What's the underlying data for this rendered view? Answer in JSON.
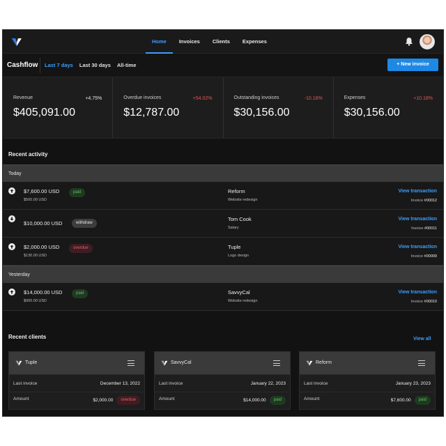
{
  "nav": {
    "items": [
      {
        "label": "Home",
        "active": true
      },
      {
        "label": "Invoices",
        "active": false
      },
      {
        "label": "Clients",
        "active": false
      },
      {
        "label": "Expenses",
        "active": false
      }
    ],
    "icons": [
      "logo-icon",
      "bell-icon",
      "avatar"
    ]
  },
  "cashflow": {
    "title": "Cashflow",
    "tabs": [
      {
        "label": "Last 7 days",
        "active": true
      },
      {
        "label": "Last 30 days",
        "active": false
      },
      {
        "label": "All-time",
        "active": false
      }
    ],
    "new_invoice_label": "+ New invoice"
  },
  "stats": [
    {
      "label": "Revenue",
      "change": "+4.75%",
      "value": "$405,091.00",
      "trend": "positive"
    },
    {
      "label": "Overdue invoices",
      "change": "+54.02%",
      "value": "$12,787.00",
      "trend": "negative"
    },
    {
      "label": "Outstanding invoices",
      "change": "-10.18%",
      "value": "$30,156.00",
      "trend": "negative"
    },
    {
      "label": "Expenses",
      "change": "+10.18%",
      "value": "$30,156.00",
      "trend": "negative"
    }
  ],
  "activity": {
    "title": "Recent activity",
    "groups": [
      {
        "label": "Today",
        "rows": [
          {
            "direction": "up",
            "amount": "$7,600.00 USD",
            "sub": "$500.00 USD",
            "status": "paid",
            "client": "Reform",
            "desc": "Website redesign",
            "link": "View transaction",
            "invoice_prefix": "Invoice",
            "invoice_no": "#00012"
          },
          {
            "direction": "down",
            "amount": "$10,000.00 USD",
            "sub": "",
            "status": "withdraw",
            "client": "Tom Cook",
            "desc": "Salary",
            "link": "View transaction",
            "invoice_prefix": "Invoice",
            "invoice_no": "#00011"
          },
          {
            "direction": "up",
            "amount": "$2,000.00 USD",
            "sub": "$130.00 USD",
            "status": "overdue",
            "client": "Tuple",
            "desc": "Logo design",
            "link": "View transaction",
            "invoice_prefix": "Invoice",
            "invoice_no": "#00009"
          }
        ]
      },
      {
        "label": "Yesterday",
        "rows": [
          {
            "direction": "up",
            "amount": "$14,000.00 USD",
            "sub": "$900.00 USD",
            "status": "paid",
            "client": "SavvyCal",
            "desc": "Website redesign",
            "link": "View transaction",
            "invoice_prefix": "Invoice",
            "invoice_no": "#00010"
          }
        ]
      }
    ]
  },
  "clients": {
    "title": "Recent clients",
    "view_all": "View all",
    "cards": [
      {
        "name": "Tuple",
        "last_invoice_label": "Last invoice",
        "last_invoice": "December 13, 2022",
        "amount_label": "Amount",
        "amount": "$2,000.00",
        "status": "overdue"
      },
      {
        "name": "SavvyCal",
        "last_invoice_label": "Last invoice",
        "last_invoice": "January 22, 2023",
        "amount_label": "Amount",
        "amount": "$14,000.00",
        "status": "paid"
      },
      {
        "name": "Reform",
        "last_invoice_label": "Last invoice",
        "last_invoice": "January 23, 2023",
        "amount_label": "Amount",
        "amount": "$7,600.00",
        "status": "paid"
      }
    ]
  },
  "colors": {
    "accent": "#3b9eff",
    "button": "#1e88e5",
    "paid": "#66bb6a",
    "overdue": "#e06070",
    "negative": "#e05858"
  }
}
